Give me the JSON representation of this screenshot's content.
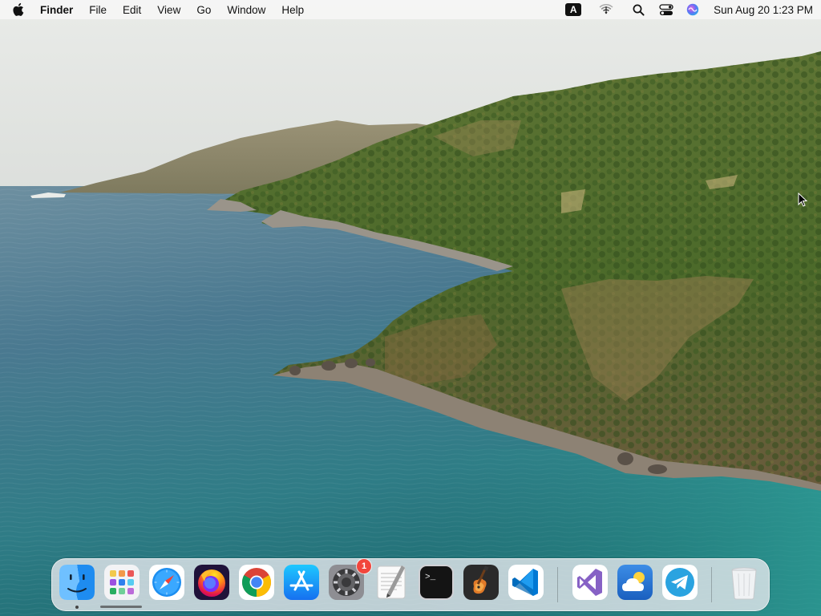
{
  "menubar": {
    "app_name": "Finder",
    "items": [
      "File",
      "Edit",
      "View",
      "Go",
      "Window",
      "Help"
    ],
    "input_source": "A",
    "clock": "Sun Aug 20  1:23 PM"
  },
  "dock": {
    "apps": [
      {
        "name": "Finder",
        "icon": "finder-icon"
      },
      {
        "name": "Launchpad",
        "icon": "launchpad-icon"
      },
      {
        "name": "Safari",
        "icon": "safari-icon"
      },
      {
        "name": "Firefox",
        "icon": "firefox-icon"
      },
      {
        "name": "Chrome",
        "icon": "chrome-icon"
      },
      {
        "name": "App Store",
        "icon": "app-store-icon"
      },
      {
        "name": "System Settings",
        "icon": "system-settings-icon",
        "badge": "1"
      },
      {
        "name": "TextEdit",
        "icon": "textedit-icon"
      },
      {
        "name": "Terminal",
        "icon": "terminal-icon"
      },
      {
        "name": "GarageBand",
        "icon": "garageband-icon"
      },
      {
        "name": "Visual Studio Code",
        "icon": "vscode-icon"
      },
      {
        "name": "Visual Studio",
        "icon": "visual-studio-icon"
      },
      {
        "name": "Weather",
        "icon": "weather-icon"
      },
      {
        "name": "Telegram",
        "icon": "telegram-icon"
      },
      {
        "name": "Trash",
        "icon": "trash-icon"
      }
    ]
  },
  "colors": {
    "sky": "#e6e8e6",
    "sea_deep": "#3d6f86",
    "sea_shallow": "#2f8a8a",
    "hill_green": "#4e6a2c",
    "menubar_bg": "#f6f6f6",
    "badge": "#f2463c"
  }
}
